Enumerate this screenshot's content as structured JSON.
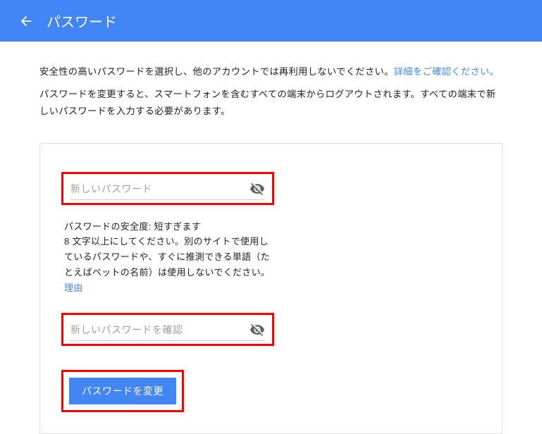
{
  "header": {
    "title": "パスワード"
  },
  "intro": {
    "p1_pre": "安全性の高いパスワードを選択し、他のアカウントでは再利用しないでください。",
    "p1_link": "詳細をご確認ください。",
    "p2": "パスワードを変更すると、スマートフォンを含むすべての端末からログアウトされます。すべての端末で新しいパスワードを入力する必要があります。"
  },
  "form": {
    "new_password_placeholder": "新しいパスワード",
    "confirm_password_placeholder": "新しいパスワードを確認",
    "strength_label_prefix": "パスワードの安全度: ",
    "strength_value": "短すぎます",
    "help_text": "8 文字以上にしてください。別のサイトで使用しているパスワードや、すぐに推測できる単語（たとえばペットの名前）は使用しないでください。",
    "help_link": "理由",
    "submit_label": "パスワードを変更"
  }
}
